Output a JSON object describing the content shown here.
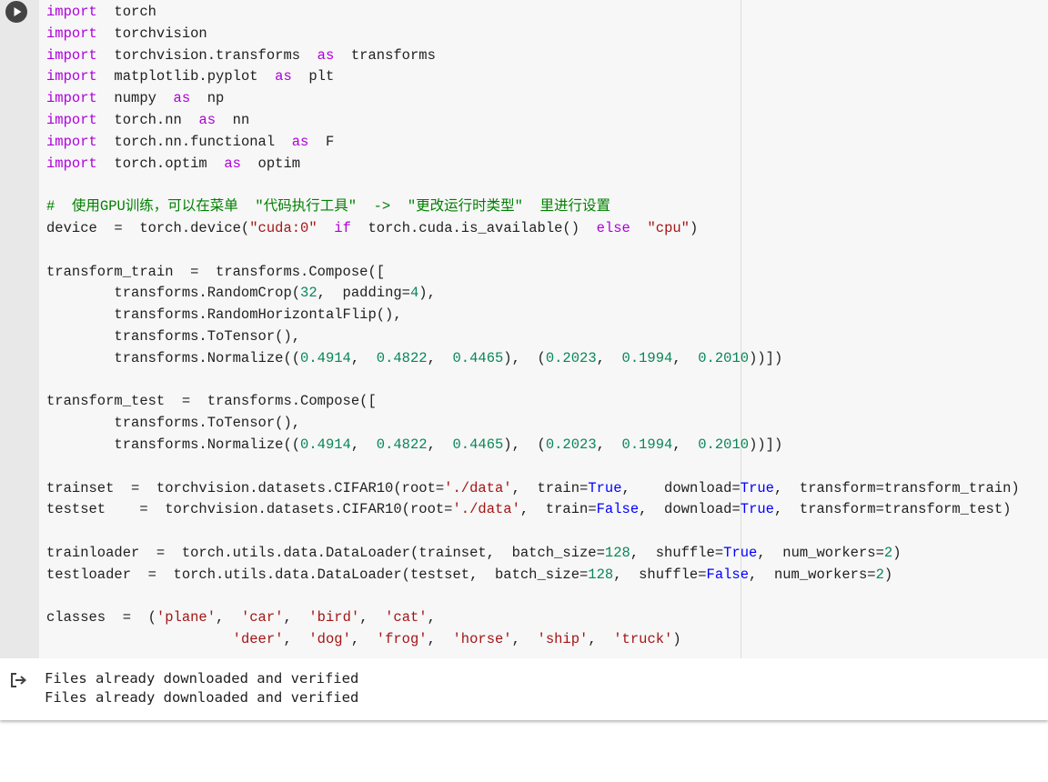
{
  "cell": {
    "run_button_icon": "play-circle-icon",
    "code_lines": [
      "import  torch",
      "import  torchvision",
      "import  torchvision.transforms  as  transforms",
      "import  matplotlib.pyplot  as  plt",
      "import  numpy  as  np",
      "import  torch.nn  as  nn",
      "import  torch.nn.functional  as  F",
      "import  torch.optim  as  optim",
      "",
      "#  使用GPU训练，可以在菜单  \"代码执行工具\"  ->  \"更改运行时类型\"  里进行设置",
      "device  =  torch.device(\"cuda:0\"  if  torch.cuda.is_available()  else  \"cpu\")",
      "",
      "transform_train  =  transforms.Compose([",
      "        transforms.RandomCrop(32,  padding=4),",
      "        transforms.RandomHorizontalFlip(),",
      "        transforms.ToTensor(),",
      "        transforms.Normalize((0.4914,  0.4822,  0.4465),  (0.2023,  0.1994,  0.2010))])",
      "",
      "transform_test  =  transforms.Compose([",
      "        transforms.ToTensor(),",
      "        transforms.Normalize((0.4914,  0.4822,  0.4465),  (0.2023,  0.1994,  0.2010))])",
      "",
      "trainset  =  torchvision.datasets.CIFAR10(root='./data',  train=True,    download=True,  transform=transform_train)",
      "testset    =  torchvision.datasets.CIFAR10(root='./data',  train=False,  download=True,  transform=transform_test)",
      "",
      "trainloader  =  torch.utils.data.DataLoader(trainset,  batch_size=128,  shuffle=True,  num_workers=2)",
      "testloader  =  torch.utils.data.DataLoader(testset,  batch_size=128,  shuffle=False,  num_workers=2)",
      "",
      "classes  =  ('plane',  'car',  'bird',  'cat',",
      "                      'deer',  'dog',  'frog',  'horse',  'ship',  'truck')"
    ]
  },
  "output": {
    "icon": "output-redirect-icon",
    "lines": [
      "Files already downloaded and verified",
      "Files already downloaded and verified"
    ]
  },
  "colors": {
    "keyword": "#af00db",
    "keyword_blue": "#0000ff",
    "number": "#098658",
    "string": "#a31515",
    "comment": "#008000",
    "text": "#212121",
    "editor_bg": "#f7f7f7",
    "gutter_bg": "#e8e8e8"
  }
}
